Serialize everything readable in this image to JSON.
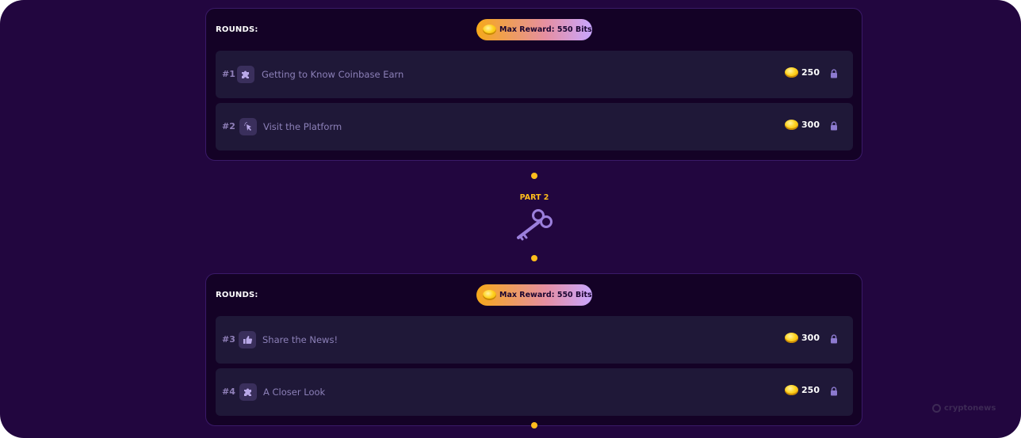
{
  "sections": [
    {
      "rounds_label": "ROUNDS:",
      "max_reward": "Max Reward: 550 Bits",
      "rounds": [
        {
          "number": "#1",
          "icon": "puzzle-icon",
          "title": "Getting to Know Coinbase Earn",
          "points": "250"
        },
        {
          "number": "#2",
          "icon": "cursor-click-icon",
          "title": "Visit the Platform",
          "points": "300"
        }
      ]
    },
    {
      "rounds_label": "ROUNDS:",
      "max_reward": "Max Reward: 550 Bits",
      "rounds": [
        {
          "number": "#3",
          "icon": "thumbs-up-icon",
          "title": "Share the News!",
          "points": "300"
        },
        {
          "number": "#4",
          "icon": "puzzle-icon",
          "title": "A Closer Look",
          "points": "250"
        }
      ]
    }
  ],
  "part": {
    "label": "PART 2",
    "icon": "key-icon"
  },
  "watermark": "cryptonews",
  "colors": {
    "background": "#22063f",
    "panel": "#140226",
    "row": "#1f1838",
    "accent": "#ffbd1c",
    "muted_text": "#8c80b8"
  }
}
